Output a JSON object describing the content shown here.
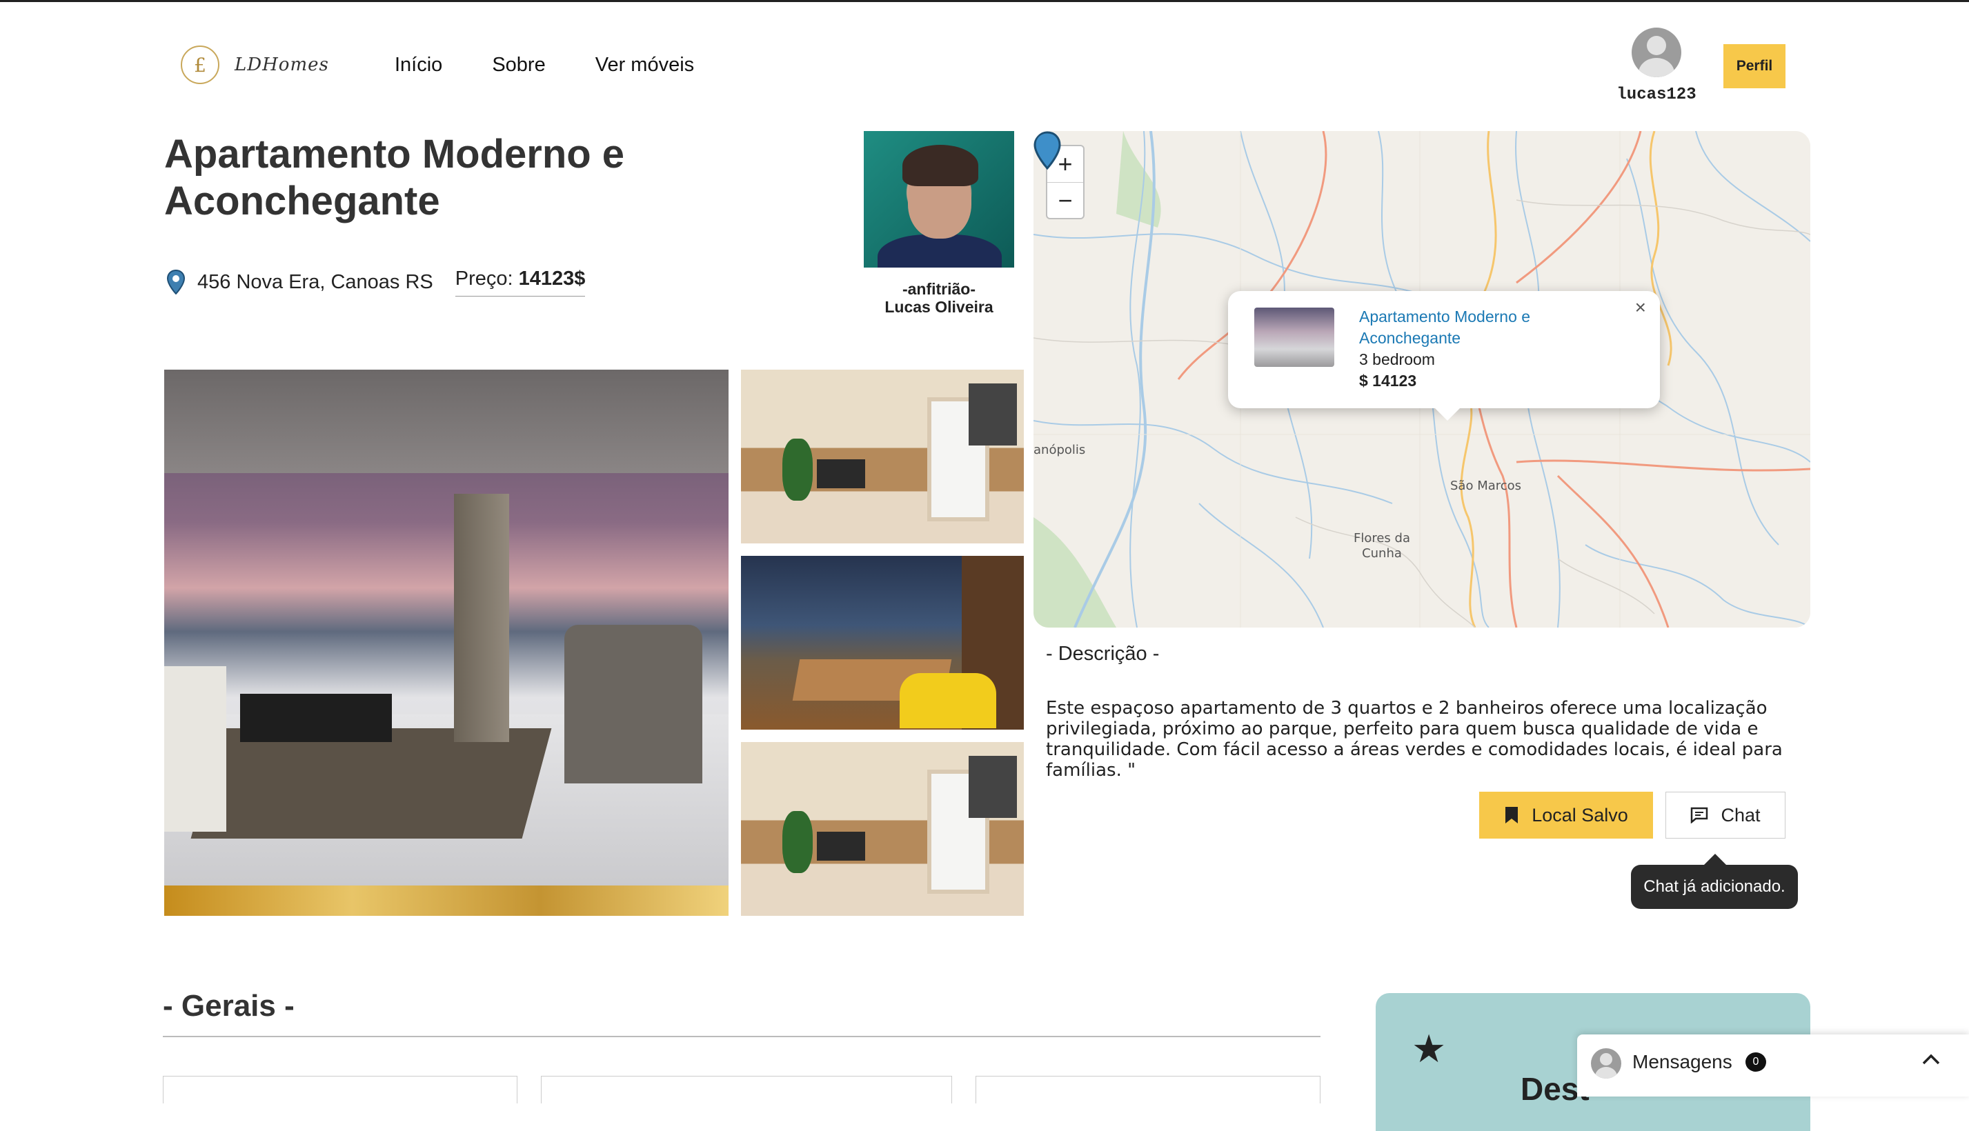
{
  "nav": {
    "logo_text": "LDHomes",
    "logo_letter": "£",
    "links": [
      "Início",
      "Sobre",
      "Ver móveis"
    ]
  },
  "user": {
    "username": "lucas123",
    "profile_button": "Perfil"
  },
  "listing": {
    "title": "Apartamento Moderno e Aconchegante",
    "address": "456 Nova Era, Canoas RS",
    "price_label": "Preço:",
    "price_value": "14123$"
  },
  "host": {
    "role": "-anfitrião-",
    "name": "Lucas Oliveira"
  },
  "map": {
    "zoom_in": "+",
    "zoom_out": "−",
    "labels": [
      "anópolis",
      "São Marcos",
      "Flores da Cunha"
    ],
    "popup": {
      "title": "Apartamento Moderno e Aconchegante",
      "bedrooms": "3 bedroom",
      "price": "$ 14123",
      "close": "×"
    }
  },
  "description": {
    "heading": "- Descrição -",
    "text": "Este espaçoso apartamento de 3 quartos e 2 banheiros oferece uma localização privilegiada, próximo ao parque, perfeito para quem busca qualidade de vida e tranquilidade. Com fácil acesso a áreas verdes e comodidades locais, é ideal para famílias. \""
  },
  "actions": {
    "saved_label": "Local Salvo",
    "chat_label": "Chat",
    "tooltip": "Chat já adicionado."
  },
  "sections": {
    "general_heading": "- Gerais -",
    "featured_heading": "Dest"
  },
  "messages": {
    "label": "Mensagens",
    "count": "0"
  },
  "colors": {
    "accent": "#f7c84a",
    "link": "#1b79b4",
    "teal": "#a8d2d2",
    "tooltip_bg": "#2b2b2b"
  }
}
